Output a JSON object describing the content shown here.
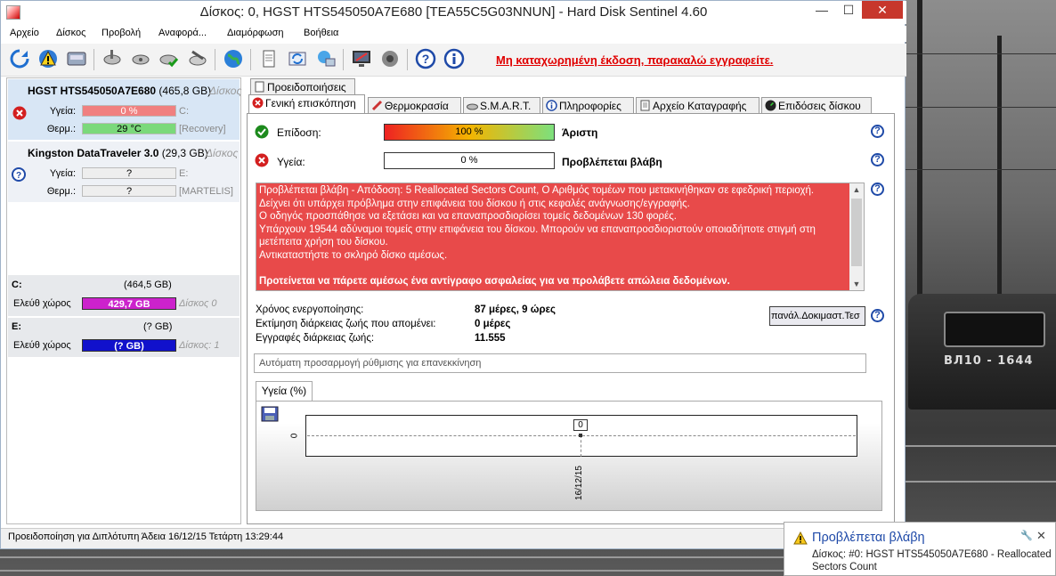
{
  "window": {
    "title": "Δίσκος: 0, HGST HTS545050A7E680 [TEA55C5G03NNUN]  -  Hard Disk Sentinel 4.60",
    "min": "—",
    "max": "☐",
    "close": "✕"
  },
  "menu": [
    "Αρχείο",
    "Δίσκος",
    "Προβολή",
    "Αναφορά...",
    "Διαμόρφωση",
    "Βοήθεια"
  ],
  "toolbar": {
    "unregistered": "Μη καταχωρημένη έκδοση, παρακαλώ εγγραφείτε."
  },
  "disks": [
    {
      "name": "HGST HTS545050A7E680",
      "size": "(465,8 GB)",
      "tag": "Δίσκος",
      "health_label": "Υγεία:",
      "health": "0 %",
      "health_side": "C:",
      "temp_label": "Θερμ.:",
      "temp": "29 °C",
      "temp_side": "[Recovery]"
    },
    {
      "name": "Kingston DataTraveler 3.0",
      "size": "(29,3 GB)",
      "tag": "Δίσκος",
      "health_label": "Υγεία:",
      "health": "?",
      "health_side": "E:",
      "temp_label": "Θερμ.:",
      "temp": "?",
      "temp_side": "[MARTELIS]"
    }
  ],
  "partitions": [
    {
      "name": "C:",
      "size": "(464,5 GB)",
      "free_label": "Ελεύθ χώρος",
      "free": "429,7 GB",
      "disk": "Δίσκος 0",
      "color": "#cc22cc"
    },
    {
      "name": "E:",
      "size": "(? GB)",
      "free_label": "Ελεύθ χώρος",
      "free": "(? GB)",
      "disk": "Δίσκος: 1",
      "color": "#1111cc"
    }
  ],
  "status_text": "Προειδοποίηση για Διπλότυπη  Άδεια 16/12/15 Τετάρτη 13:29:44",
  "tabs_top": [
    "Προειδοποιήσεις"
  ],
  "tabs": [
    "Γενική επισκόπηση",
    "Θερμοκρασία",
    "S.M.A.R.T.",
    "Πληροφορίες",
    "Αρχείο Καταγραφής",
    "Επιδόσεις δίσκου"
  ],
  "overview": {
    "performance_label": "Επίδοση:",
    "performance_value": "100 %",
    "performance_fraction": 1.0,
    "performance_verdict": "Άριστη",
    "health_label": "Υγεία:",
    "health_value": "0 %",
    "health_fraction": 0.0,
    "health_verdict": "Προβλέπεται βλάβη",
    "help": "?",
    "message": [
      "Προβλέπεται βλάβη - Απόδοση: 5 Reallocated Sectors Count, Ο Αριθμός τομέων που μετακινήθηκαν σε εφεδρική περιοχή.",
      "Δείχνει ότι υπάρχει πρόβλημα στην επιφάνεια του δίσκου ή στις κεφαλές ανάγνωσης/εγγραφής.",
      "Ο οδηγός προσπάθησε να εξετάσει και να επαναπροσδιορίσει τομείς δεδομένων 130 φορές.",
      "Υπάρχουν 19544 αδύναμοι τομείς στην επιφάνεια του δίσκου. Μπορούν να επαναπροσδιοριστούν οποιαδήποτε στιγμή στη",
      "μετέπειτα χρήση του δίσκου.",
      "Αντικαταστήστε το σκληρό δίσκο αμέσως."
    ],
    "message_bold": "Προτείνεται να πάρετε αμέσως ένα αντίγραφο ασφαλείας για να προλάβετε απώλεια δεδομένων.",
    "stats": [
      {
        "label": "Χρόνος ενεργοποίησης:",
        "value": "87 μέρες, 9 ώρες"
      },
      {
        "label": "Εκτίμηση διάρκειας ζωής που απομένει:",
        "value": "0 μέρες"
      },
      {
        "label": "Εγγραφές διάρκειας ζωής:",
        "value": "11.555"
      }
    ],
    "test_button": "πανάλ.Δοκιμαστ.Τεσ",
    "auto_field": "Αυτόματη προσαρμογή ρύθμισης για επανεκκίνηση",
    "chart_tab": "Υγεία (%)"
  },
  "chart_data": {
    "type": "line",
    "x": [
      "16/12/15"
    ],
    "series": [
      {
        "values": [
          0
        ]
      }
    ],
    "y_ticks": [
      "0"
    ],
    "point_label": "0",
    "title": "",
    "xlabel": "",
    "ylabel": ""
  },
  "toast": {
    "title": "Προβλέπεται βλάβη",
    "text": "Δίσκος: #0: HGST HTS545050A7E680 - Reallocated Sectors Count",
    "pin": "🔧",
    "close": "✕"
  },
  "background": {
    "train_number": "ВЛ10 - 1644"
  },
  "colors": {
    "accent_blue": "#1f4aa8",
    "danger_red": "#e84a4a",
    "unreg_red": "#e00000"
  }
}
